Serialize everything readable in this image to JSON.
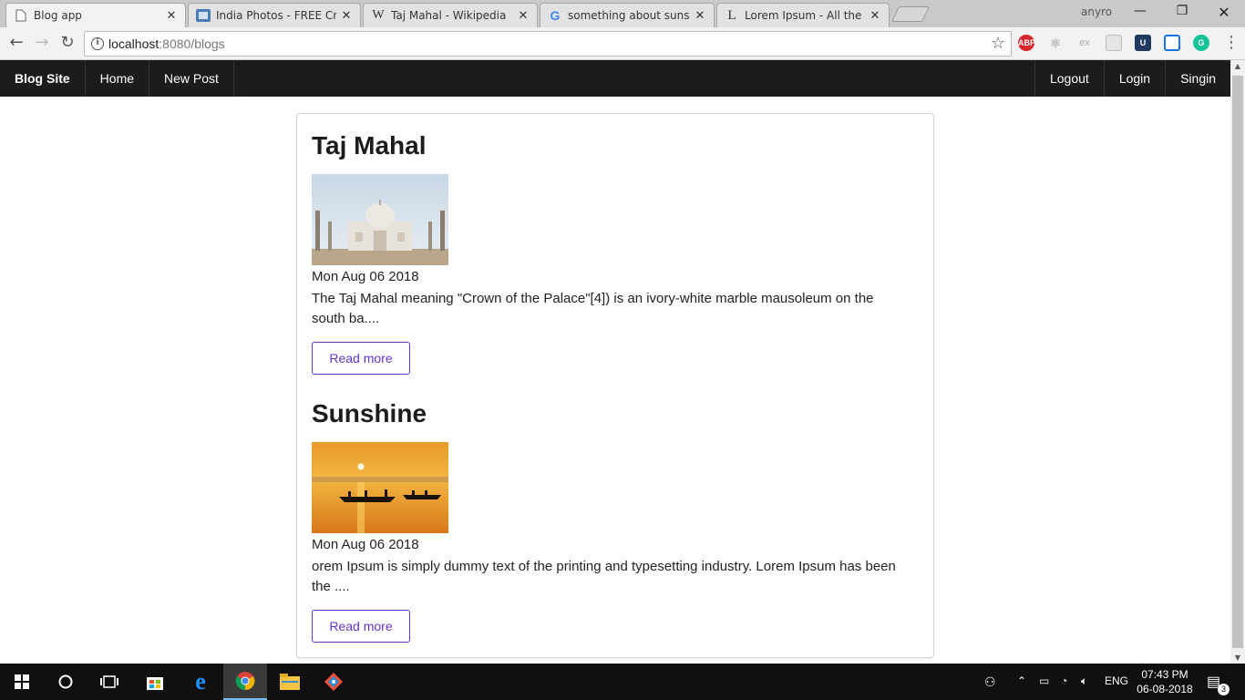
{
  "browser": {
    "tabs": [
      {
        "title": "Blog app",
        "active": true
      },
      {
        "title": "India Photos - FREE Creat",
        "active": false
      },
      {
        "title": "Taj Mahal - Wikipedia",
        "active": false
      },
      {
        "title": "something about sunshin",
        "active": false
      },
      {
        "title": "Lorem Ipsum - All the fac",
        "active": false
      }
    ],
    "profile_name": "anyro",
    "url_host": "localhost",
    "url_path": ":8080/blogs",
    "extensions": [
      "ABP",
      "ex"
    ]
  },
  "navbar": {
    "brand": "Blog Site",
    "left_items": [
      "Home",
      "New Post"
    ],
    "right_items": [
      "Logout",
      "Login",
      "Singin"
    ]
  },
  "posts": [
    {
      "title": "Taj Mahal",
      "date": "Mon Aug 06 2018",
      "excerpt": "The Taj Mahal meaning \"Crown of the Palace\"[4]) is an ivory-white marble mausoleum on the south ba....",
      "read_more": "Read more"
    },
    {
      "title": "Sunshine",
      "date": "Mon Aug 06 2018",
      "excerpt": "orem Ipsum is simply dummy text of the printing and typesetting industry. Lorem Ipsum has been the ....",
      "read_more": "Read more"
    }
  ],
  "taskbar": {
    "language": "ENG",
    "time": "07:43 PM",
    "date": "06-08-2018",
    "notifications": "3"
  },
  "colors": {
    "navbar_bg": "#1b1c1d",
    "button_accent": "#6435c9"
  }
}
